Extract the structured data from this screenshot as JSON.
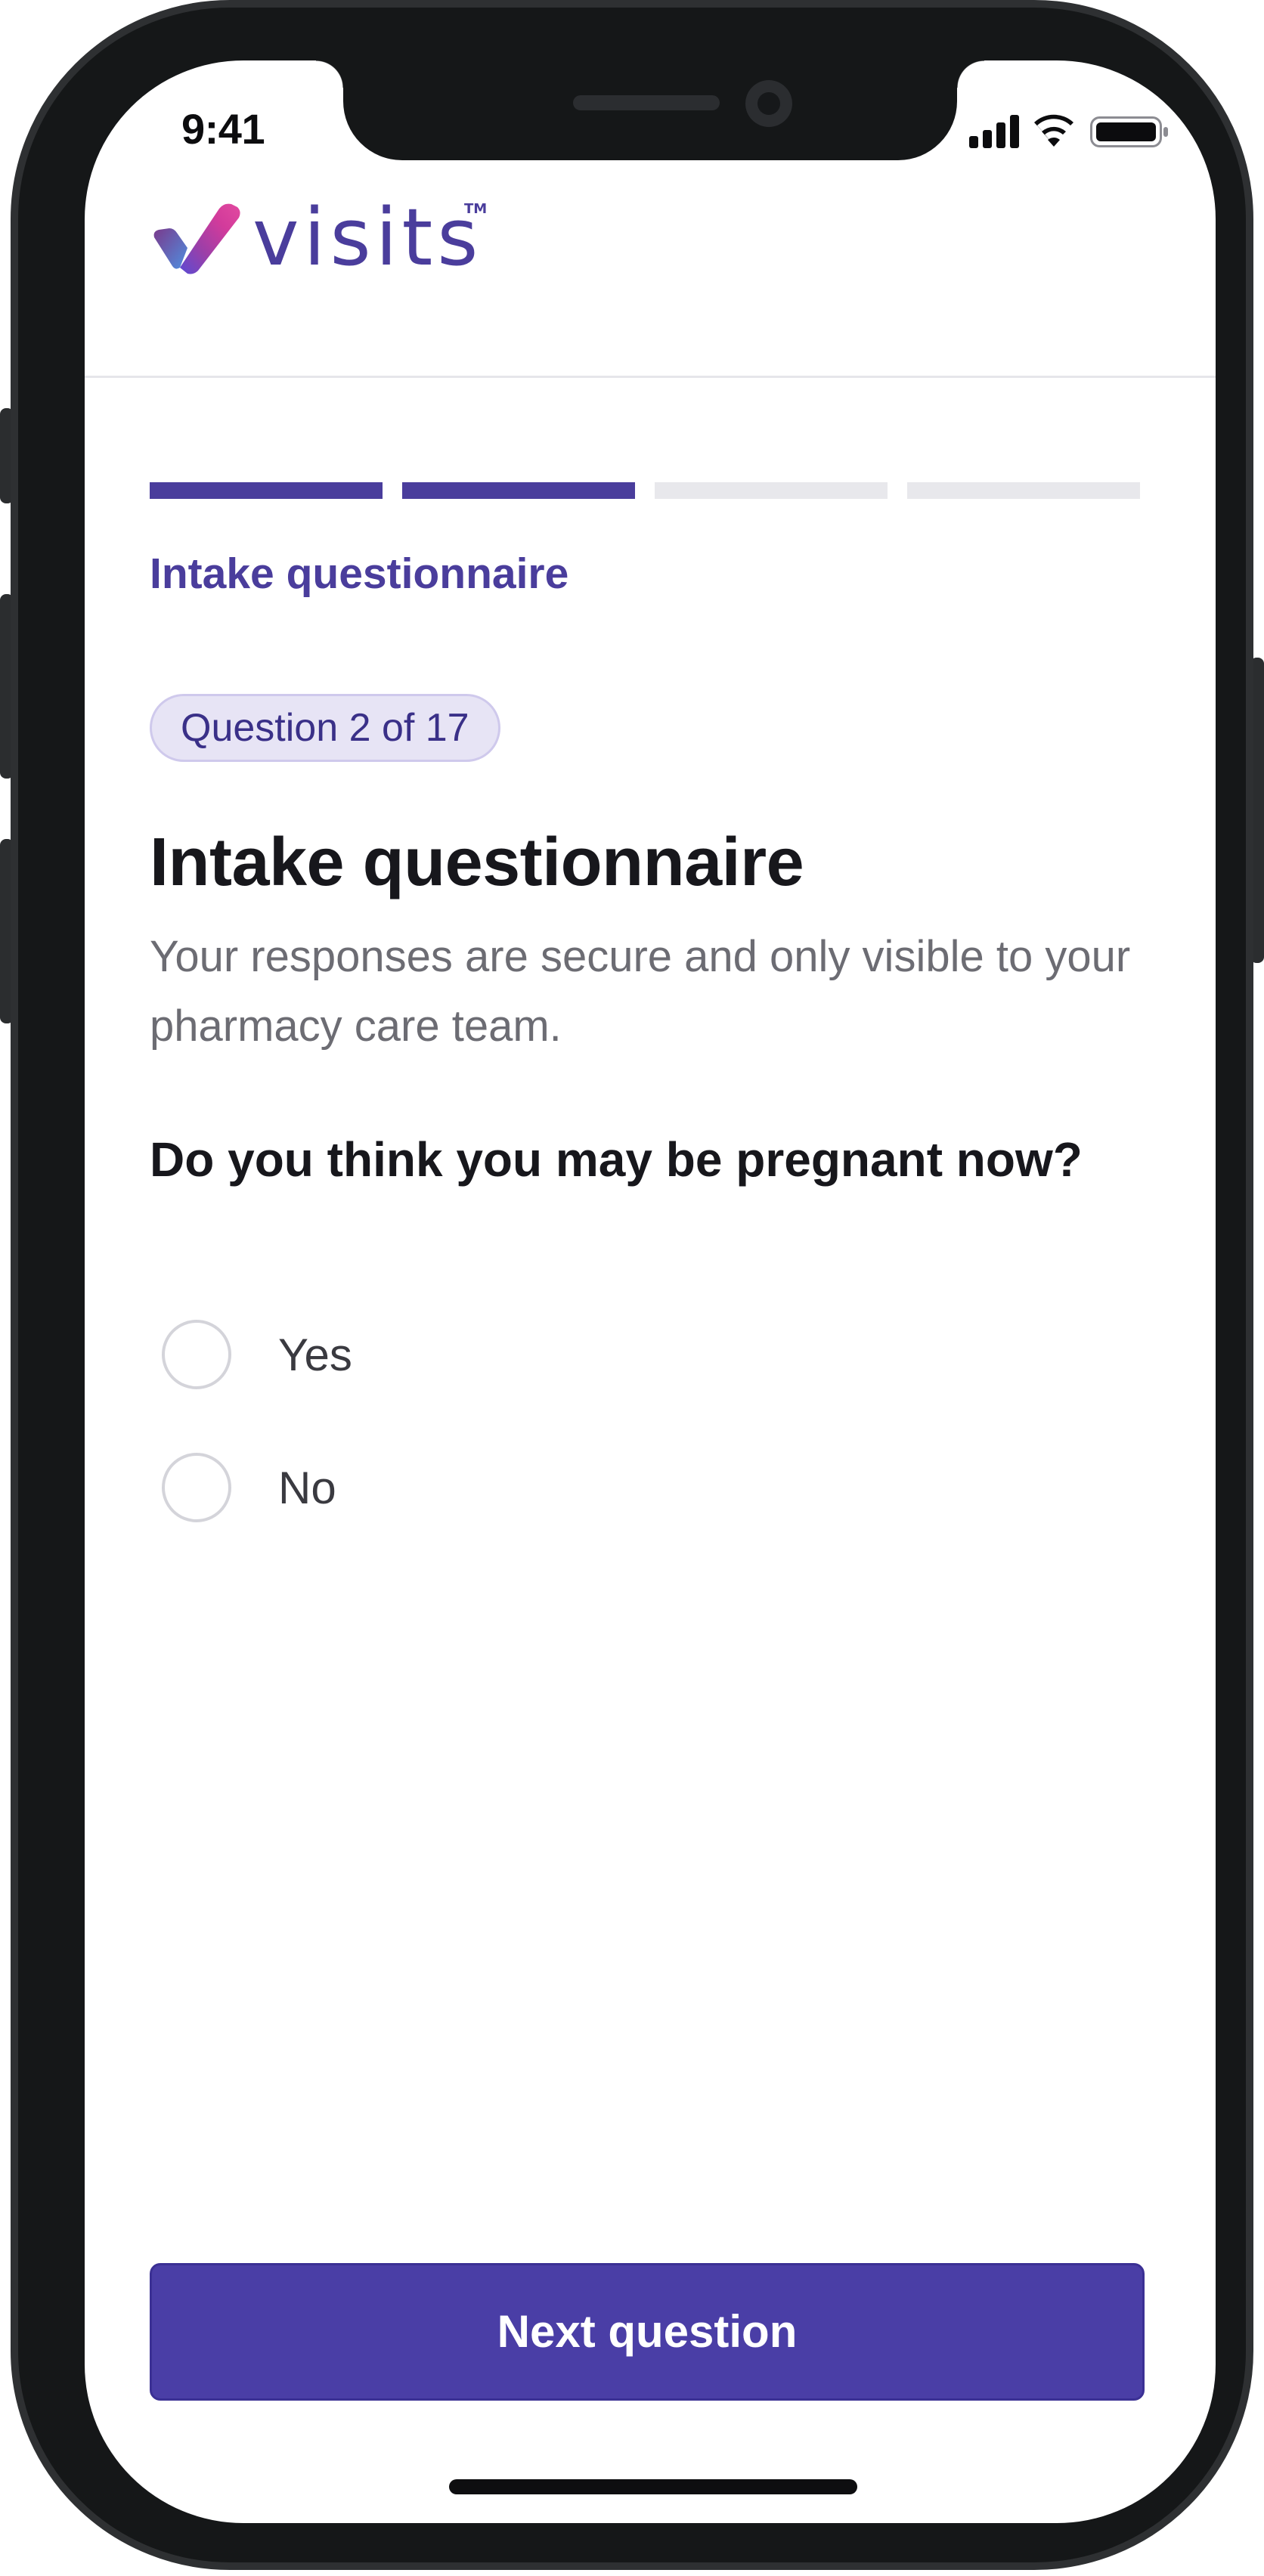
{
  "status_bar": {
    "time": "9:41",
    "icons": [
      "signal-icon",
      "wifi-icon",
      "battery-icon"
    ]
  },
  "header": {
    "logo_text": "visits",
    "logo_tm": "TM"
  },
  "progress": {
    "total_steps": 4,
    "completed_steps": 2
  },
  "section_label": "Intake questionnaire",
  "question_badge": "Question 2 of 17",
  "page_title": "Intake questionnaire",
  "subtitle": "Your responses are secure and only visible to your pharmacy care team.",
  "question": {
    "text": "Do you think you may be pregnant now?",
    "options": [
      {
        "label": "Yes",
        "selected": false
      },
      {
        "label": "No",
        "selected": false
      }
    ]
  },
  "next_button_label": "Next question",
  "colors": {
    "brand": "#4a3d9c",
    "button": "#4a3ea6",
    "progress_empty": "#e8e8ec",
    "badge_bg": "#e7e4f5"
  }
}
